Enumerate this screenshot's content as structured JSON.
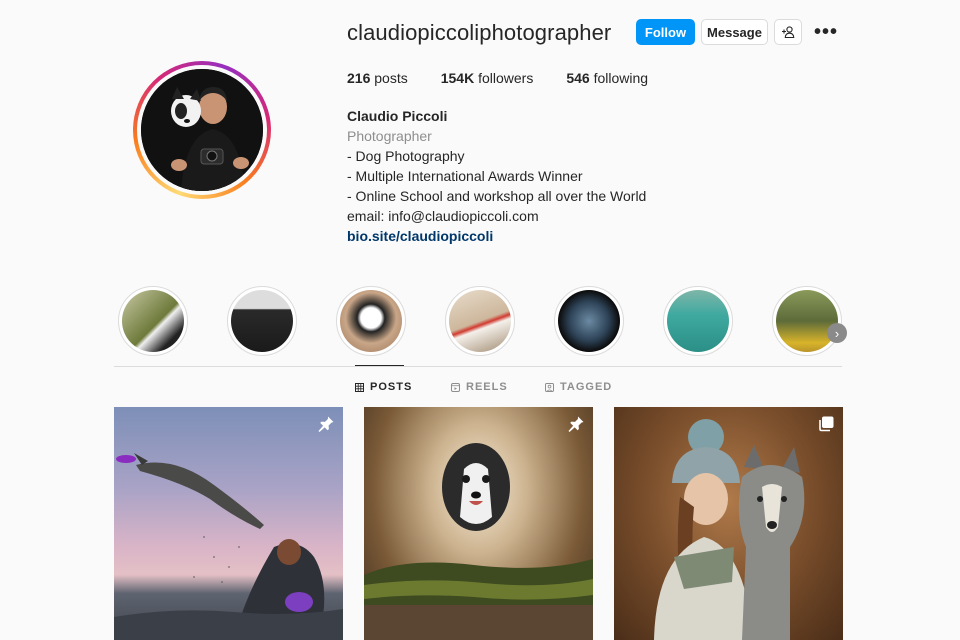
{
  "profile": {
    "username": "claudiopiccoliphotographer",
    "follow_label": "Follow",
    "message_label": "Message",
    "more_label": "•••",
    "stats": {
      "posts_count": "216",
      "posts_label": "posts",
      "followers_count": "154K",
      "followers_label": "followers",
      "following_count": "546",
      "following_label": "following"
    },
    "bio": {
      "name": "Claudio Piccoli",
      "category": "Photographer",
      "lines": [
        "- Dog Photography",
        "- Multiple International Awards Winner",
        "- Online School and workshop all over the World",
        "email: info@claudiopiccoli.com"
      ],
      "link": "bio.site/claudiopiccoli"
    }
  },
  "highlights": [
    {
      "name": "highlight-1"
    },
    {
      "name": "highlight-2"
    },
    {
      "name": "highlight-3"
    },
    {
      "name": "highlight-4"
    },
    {
      "name": "highlight-5"
    },
    {
      "name": "highlight-6"
    },
    {
      "name": "highlight-7"
    }
  ],
  "tabs": [
    {
      "label": "POSTS",
      "icon": "grid-icon",
      "active": true
    },
    {
      "label": "REELS",
      "icon": "reels-icon",
      "active": false
    },
    {
      "label": "TAGGED",
      "icon": "tagged-icon",
      "active": false
    }
  ],
  "posts": [
    {
      "badge": "pin-icon"
    },
    {
      "badge": "pin-icon"
    },
    {
      "badge": "carousel-icon"
    }
  ],
  "colors": {
    "accent": "#0095f6",
    "link": "#00376b",
    "muted": "#8e8e8e"
  }
}
